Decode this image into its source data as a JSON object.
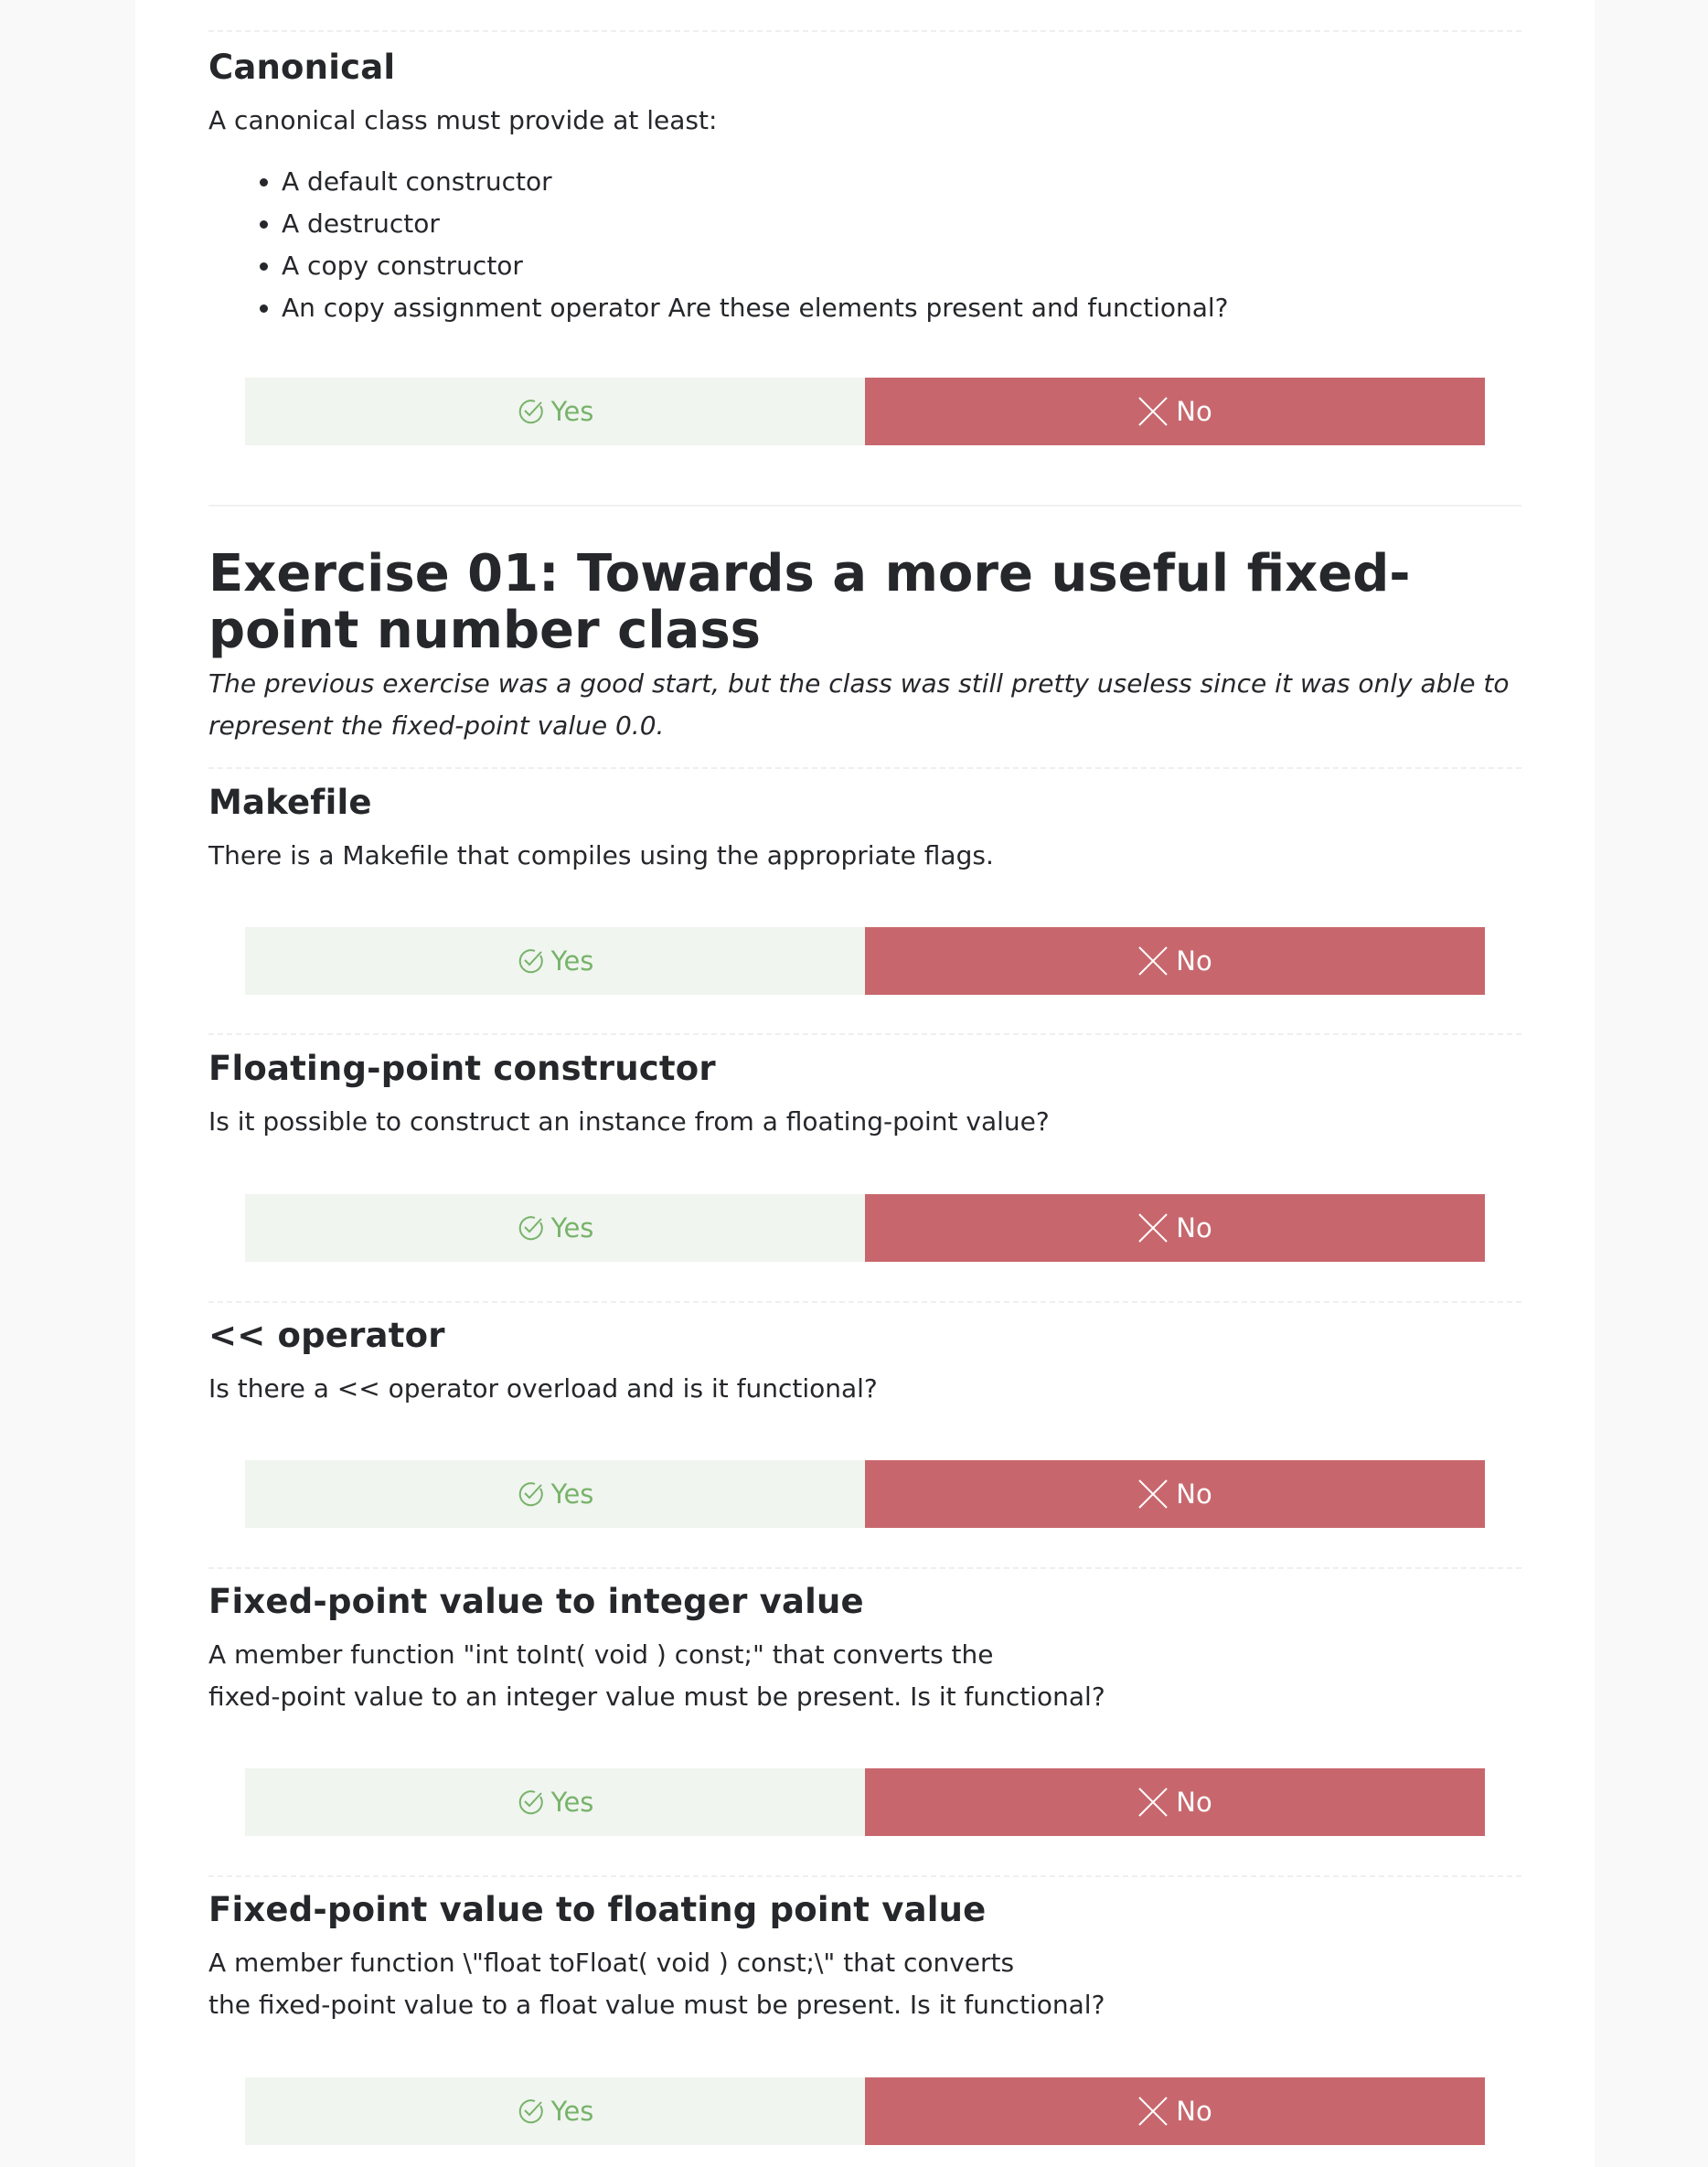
{
  "sections_top": {
    "canonical": {
      "title": "Canonical",
      "text": "A canonical class must provide at least:",
      "items": [
        "A default constructor",
        "A destructor",
        "A copy constructor",
        "An copy assignment operator Are these elements present and functional?"
      ]
    }
  },
  "exercise": {
    "title": "Exercise 01: Towards a more useful fixed-point number class",
    "intro": "The previous exercise was a good start, but the class was still pretty useless since it was only able to represent the fixed-point value 0.0."
  },
  "checks": [
    {
      "title": "Makefile",
      "text": [
        "There is a Makefile that compiles using the appropriate flags."
      ]
    },
    {
      "title": "Floating-point constructor",
      "text": [
        "Is it possible to construct an instance from a floating-point value?"
      ]
    },
    {
      "title": "<< operator",
      "text": [
        "Is there a << operator overload and is it functional?"
      ]
    },
    {
      "title": "Fixed-point value to integer value",
      "text": [
        "A member function \"int toInt( void ) const;\" that converts the",
        "fixed-point value to an integer value must be present. Is it functional?"
      ]
    },
    {
      "title": "Fixed-point value to floating point value",
      "text": [
        "A member function \\\"float toFloat( void ) const;\\\" that converts",
        "the fixed-point value to a float value must be present. Is it functional?"
      ]
    }
  ],
  "buttons": {
    "yes_label": "Yes",
    "no_label": "No",
    "yes_icon": "check-circle-icon",
    "no_icon": "cross-icon"
  },
  "colors": {
    "yes_bg": "#f0f5ef",
    "yes_fg": "#78b36b",
    "no_bg": "#c7676d",
    "no_fg": "#ffffff"
  }
}
